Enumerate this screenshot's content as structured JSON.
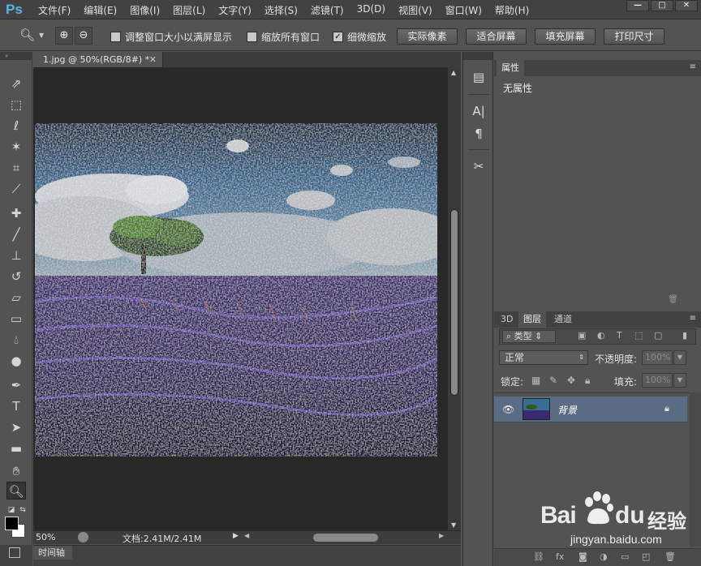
{
  "app": {
    "logo": "Ps"
  },
  "menu": [
    "文件(F)",
    "编辑(E)",
    "图像(I)",
    "图层(L)",
    "文字(Y)",
    "选择(S)",
    "滤镜(T)",
    "3D(D)",
    "视图(V)",
    "窗口(W)",
    "帮助(H)"
  ],
  "window_buttons": {
    "minimize": "—",
    "restore": "□",
    "close": "✕"
  },
  "options": {
    "resize_windows": {
      "label": "调整窗口大小以满屏显示",
      "checked": false
    },
    "zoom_all_windows": {
      "label": "缩放所有窗口",
      "checked": false
    },
    "scrubby_zoom": {
      "label": "细微缩放",
      "checked": true
    },
    "actual_pixels": "实际像素",
    "fit_screen": "适合屏幕",
    "fill_screen": "填充屏幕",
    "print_size": "打印尺寸"
  },
  "document": {
    "tab_title": "1.jpg @ 50%(RGB/8#) *",
    "zoom": "50%",
    "doc_info": "文档:2.41M/2.41M"
  },
  "timeline": {
    "label": "时间轴"
  },
  "properties": {
    "tab": "属性",
    "content": "无属性"
  },
  "layers": {
    "tabs": [
      "3D",
      "图层",
      "通道"
    ],
    "filter_kind": "类型",
    "blend_mode": "正常",
    "opacity_label": "不透明度:",
    "opacity_value": "100%",
    "lock_label": "锁定:",
    "fill_label": "填充:",
    "fill_value": "100%",
    "items": [
      {
        "name": "背景",
        "visible": true,
        "locked": true
      }
    ]
  },
  "watermark": {
    "brand_left": "Bai",
    "brand_right": "du",
    "brand_zh": "经验",
    "url": "jingyan.baidu.com"
  },
  "colors": {
    "ui_dark": "#535353",
    "canvas_bg": "#282828",
    "layer_selected": "#5a6b84",
    "ps_blue": "#5ab4e8"
  }
}
